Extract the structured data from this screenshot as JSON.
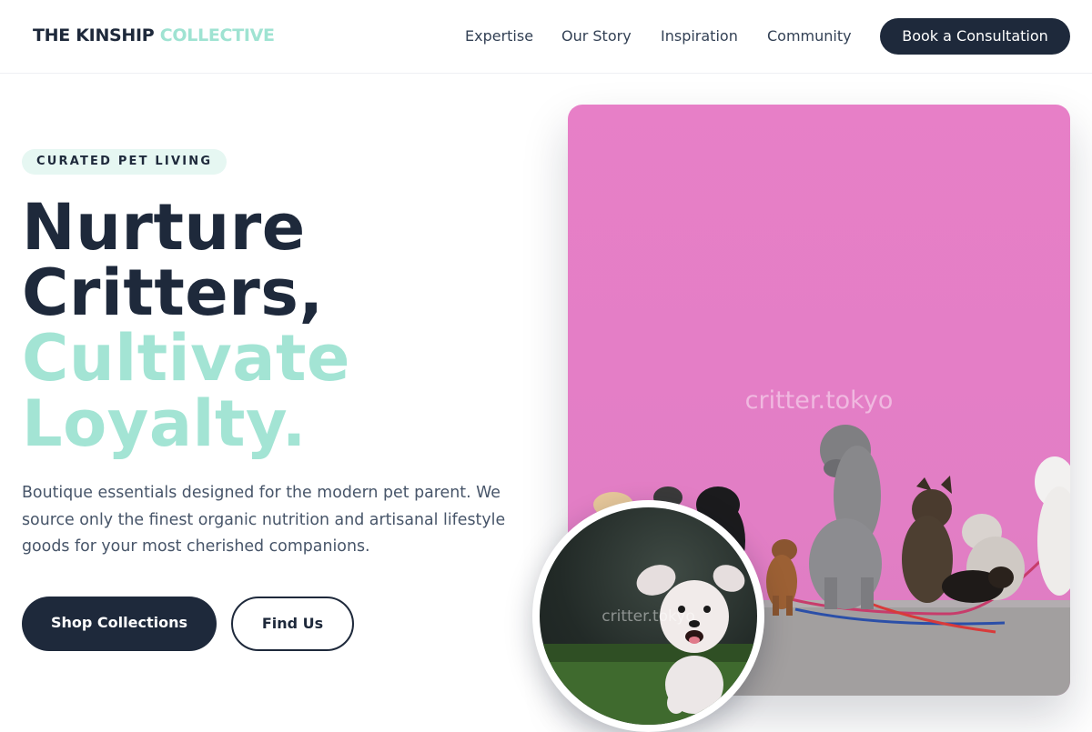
{
  "brand": {
    "name_main": "THE KINSHIP",
    "name_accent": "COLLECTIVE",
    "colors": {
      "navy": "#1e293b",
      "mint": "#a3e4d4",
      "mint_tint": "#e6f7f2",
      "photo_pink": "#e27ec5"
    }
  },
  "nav": {
    "links": [
      "Expertise",
      "Our Story",
      "Inspiration",
      "Community"
    ],
    "cta": "Book a Consultation"
  },
  "hero": {
    "eyebrow": "CURATED PET LIVING",
    "headline_line1": "Nurture",
    "headline_line2": "Critters,",
    "headline_line3": "Cultivate",
    "headline_line4": "Loyalty.",
    "lead": "Boutique essentials designed for the modern pet parent. We source only the finest organic nutrition and artisanal lifestyle goods for your most cherished companions.",
    "primary_cta": "Shop Collections",
    "secondary_cta": "Find Us"
  },
  "media": {
    "main_photo_watermark": "critter.tokyo",
    "inset_photo_watermark": "critter.tokyo",
    "main_photo_icon": "dogs-on-leashes-against-pink-wall",
    "inset_photo_icon": "fluffy-white-dog-running-on-grass"
  }
}
